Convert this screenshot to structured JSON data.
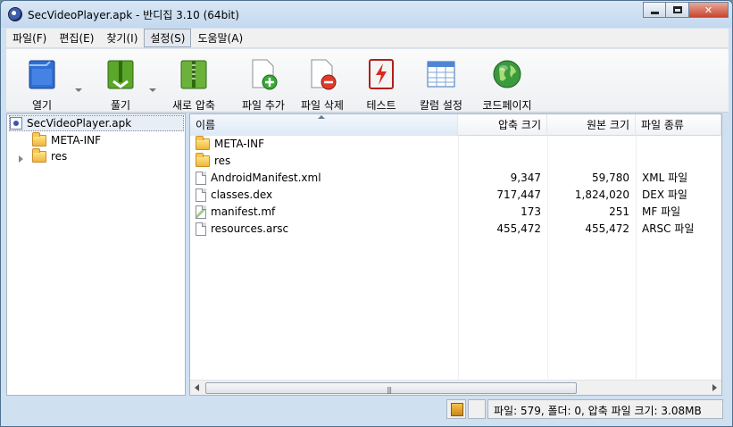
{
  "window": {
    "title": "SecVideoPlayer.apk - 반디집 3.10 (64bit)",
    "controls": {
      "close": "✕"
    }
  },
  "menu": [
    "파일(F)",
    "편집(E)",
    "찾기(I)",
    "설정(S)",
    "도움말(A)"
  ],
  "toolbar": {
    "open": "열기",
    "extract": "풀기",
    "new_archive": "새로 압축",
    "add_file": "파일 추가",
    "delete_file": "파일 삭제",
    "test": "테스트",
    "column_settings": "칼럼 설정",
    "codepage": "코드페이지"
  },
  "tree": {
    "root": "SecVideoPlayer.apk",
    "children": [
      "META-INF",
      "res"
    ]
  },
  "list": {
    "columns": [
      "이름",
      "압축 크기",
      "원본 크기",
      "파일 종류"
    ],
    "rows": [
      {
        "name": "META-INF",
        "packed": "",
        "original": "",
        "type": "",
        "icon": "folder-icon"
      },
      {
        "name": "res",
        "packed": "",
        "original": "",
        "type": "",
        "icon": "folder-icon"
      },
      {
        "name": "AndroidManifest.xml",
        "packed": "9,347",
        "original": "59,780",
        "type": "XML 파일",
        "icon": "file-icon"
      },
      {
        "name": "classes.dex",
        "packed": "717,447",
        "original": "1,824,020",
        "type": "DEX 파일",
        "icon": "file-icon"
      },
      {
        "name": "manifest.mf",
        "packed": "173",
        "original": "251",
        "type": "MF 파일",
        "icon": "mf-file-icon"
      },
      {
        "name": "resources.arsc",
        "packed": "455,472",
        "original": "455,472",
        "type": "ARSC 파일",
        "icon": "file-icon"
      }
    ],
    "scroll_grip": "|||"
  },
  "status": {
    "summary": "파일: 579, 폴더: 0, 압축 파일 크기: 3.08MB"
  }
}
